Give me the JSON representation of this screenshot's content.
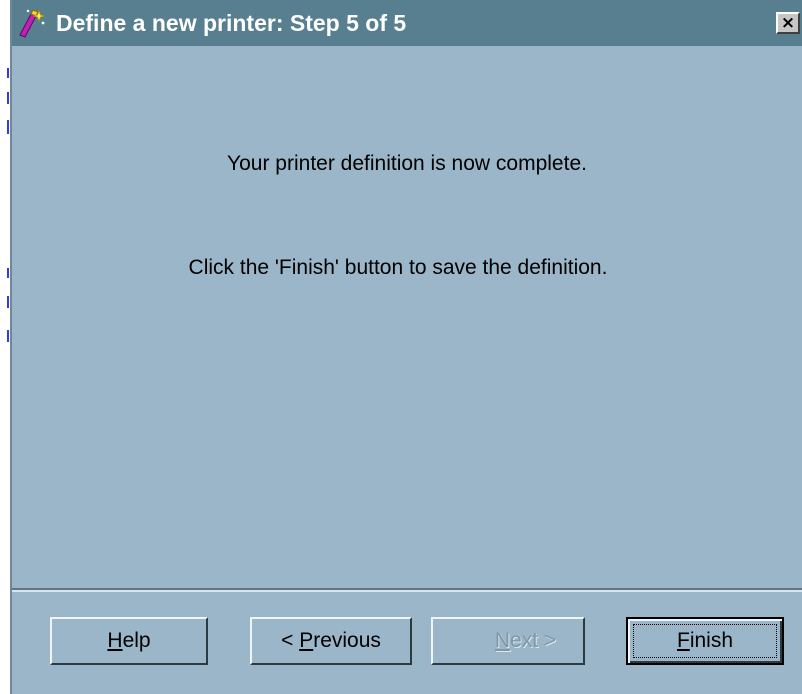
{
  "window": {
    "title": "Define a new printer: Step 5 of 5",
    "close_label": "×",
    "icon": "wizard-wand-icon"
  },
  "message": {
    "line1": "Your printer definition is now complete.",
    "line2": "Click the 'Finish' button to save the definition."
  },
  "buttons": {
    "help": {
      "mnemonic": "H",
      "rest": "elp"
    },
    "previous": {
      "prefix": "< ",
      "mnemonic": "P",
      "rest": "revious",
      "enabled": true
    },
    "next": {
      "mnemonic": "N",
      "rest": "ext",
      "suffix": " >",
      "enabled": false
    },
    "finish": {
      "mnemonic": "F",
      "rest": "inish",
      "default": true
    }
  },
  "colors": {
    "titlebar": "#577f90",
    "dialog_background": "#9bb6c8",
    "title_text": "#ffffff",
    "disabled_text": "#7f97a6"
  }
}
